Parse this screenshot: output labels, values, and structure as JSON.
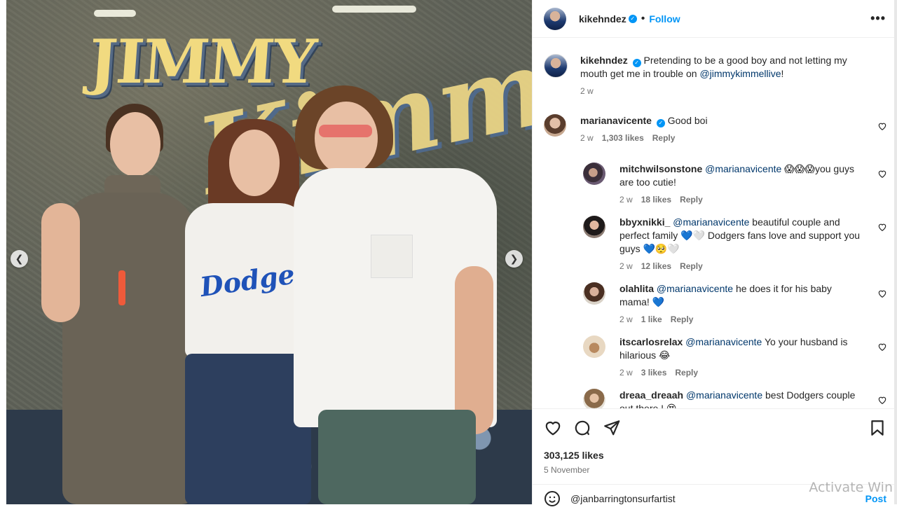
{
  "post": {
    "author": "kikehndez",
    "follow_label": "Follow",
    "more_label": "•••",
    "caption_user": "kikehndez",
    "caption_text_1": "Pretending to be a good boy and not letting my mouth get me in trouble on ",
    "caption_mention": "@jimmykimmellive",
    "caption_text_2": "!",
    "caption_time": "2 w"
  },
  "photo": {
    "sign_line1": "JIMMY",
    "sign_line2": "Kimmel",
    "shirt_text": "Dodgers",
    "prev_icon": "chevron-left-icon",
    "next_icon": "chevron-right-icon"
  },
  "comments": [
    {
      "user": "marianavicente",
      "verified": true,
      "text": "Good boi",
      "mention": "",
      "time": "2 w",
      "likes": "1,303 likes",
      "reply": "Reply"
    },
    {
      "user": "mitchwilsonstone",
      "mention": "@marianavicente",
      "text": " 😱😱😱you guys are too cutie!",
      "time": "2 w",
      "likes": "18 likes",
      "reply": "Reply"
    },
    {
      "user": "bbyxnikki_",
      "mention": "@marianavicente",
      "text": " beautiful couple and perfect family 💙🤍 Dodgers fans love and support you guys 💙🥺🤍",
      "time": "2 w",
      "likes": "12 likes",
      "reply": "Reply"
    },
    {
      "user": "olahlita",
      "mention": "@marianavicente",
      "text": " he does it for his baby mama! 💙",
      "time": "2 w",
      "likes": "1 like",
      "reply": "Reply"
    },
    {
      "user": "itscarlosrelax",
      "mention": "@marianavicente",
      "text": " Yo your husband is hilarious 😂",
      "time": "2 w",
      "likes": "3 likes",
      "reply": "Reply"
    },
    {
      "user": "dreaa_dreaah",
      "mention": "@marianavicente",
      "text": " best Dodgers couple out there ! 😍",
      "time": "",
      "likes": "",
      "reply": ""
    }
  ],
  "actions": {
    "likes": "303,125 likes",
    "date": "5 November",
    "add_comment_user": "@janbarringtonsurfartist",
    "post_label": "Post"
  },
  "watermark": "Activate Win",
  "colors": {
    "accent": "#0095f6",
    "mention": "#00376b",
    "muted": "#737373"
  }
}
